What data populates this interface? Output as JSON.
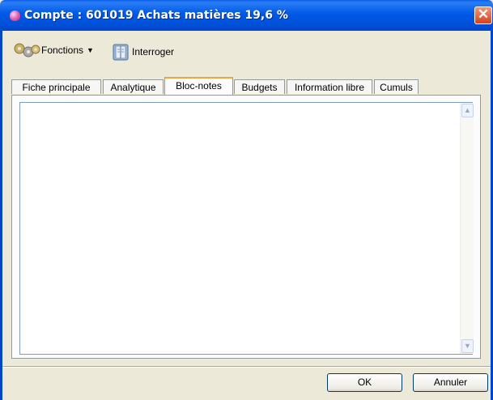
{
  "window": {
    "title": "Compte : 601019 Achats matières 19,6 %",
    "close_glyph": "✕"
  },
  "toolbar": {
    "functions_label": "Fonctions",
    "functions_icon": "gear-icon",
    "query_label": "Interroger",
    "query_icon": "book-icon"
  },
  "tabs": [
    {
      "label": "Fiche principale",
      "active": false
    },
    {
      "label": "Analytique",
      "active": false
    },
    {
      "label": "Bloc-notes",
      "active": true
    },
    {
      "label": "Budgets",
      "active": false
    },
    {
      "label": "Information libre",
      "active": false
    },
    {
      "label": "Cumuls",
      "active": false
    }
  ],
  "notes": {
    "value": ""
  },
  "footer": {
    "ok_label": "OK",
    "cancel_label": "Annuler"
  },
  "colors": {
    "titlebar": "#0058e6",
    "active_tab_accent": "#f2a33b",
    "close": "#d5421c"
  }
}
